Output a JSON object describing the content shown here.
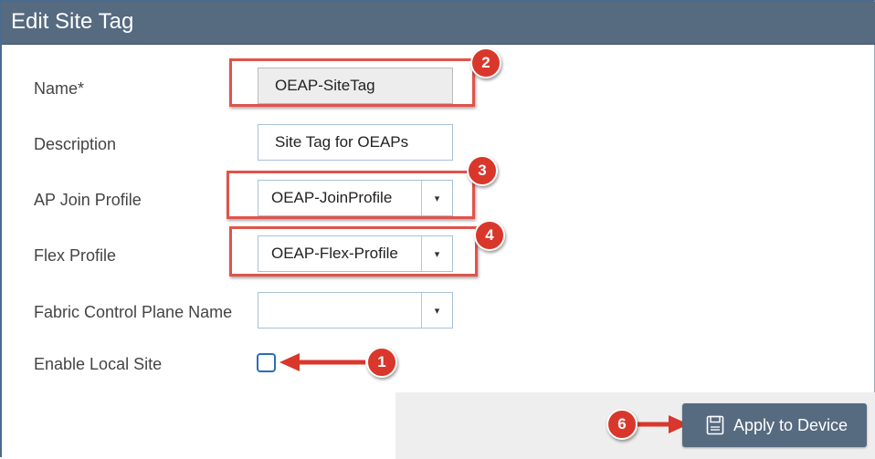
{
  "dialog": {
    "title": "Edit Site Tag"
  },
  "form": {
    "name": {
      "label": "Name*",
      "value": "OEAP-SiteTag"
    },
    "description": {
      "label": "Description",
      "value": "Site Tag for OEAPs"
    },
    "ap_join_profile": {
      "label": "AP Join Profile",
      "value": "OEAP-JoinProfile"
    },
    "flex_profile": {
      "label": "Flex Profile",
      "value": "OEAP-Flex-Profile"
    },
    "fabric_control_plane": {
      "label": "Fabric Control Plane Name",
      "value": ""
    },
    "enable_local_site": {
      "label": "Enable Local Site",
      "checked": false
    }
  },
  "footer": {
    "apply_label": "Apply to Device",
    "apply_icon": "save-icon"
  },
  "annotations": {
    "badges": [
      "1",
      "2",
      "3",
      "4",
      "6"
    ],
    "color": "#d9372c"
  },
  "dropdown_icon": "▾",
  "colors": {
    "titlebar": "#566a80",
    "button": "#566a80",
    "highlight": "#e0534b",
    "checkbox": "#2a6db7"
  }
}
